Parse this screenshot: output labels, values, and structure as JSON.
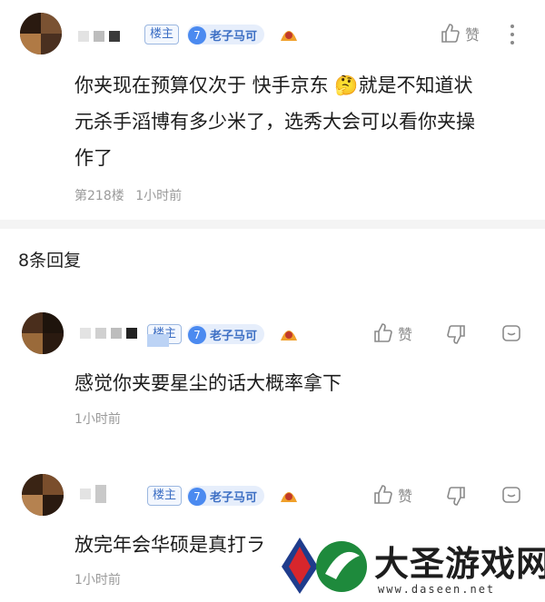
{
  "main_comment": {
    "tag": "楼主",
    "level": "7",
    "level_title": "老子马可",
    "like_label": "赞",
    "content_line1": "你夹现在预算仅次于 快手京东 🤔就是不知道状",
    "content_line2": "元杀手滔博有多少米了，选秀大会可以看你夹操",
    "content_line3": "作了",
    "floor": "第218楼",
    "time": "1小时前"
  },
  "reply_section": {
    "count_label": "8条回复"
  },
  "replies": [
    {
      "tag": "楼主",
      "level": "7",
      "level_title": "老子马可",
      "like_label": "赞",
      "content": "感觉你夹要星尘的话大概率拿下",
      "time": "1小时前"
    },
    {
      "tag": "楼主",
      "level": "7",
      "level_title": "老子马可",
      "like_label": "赞",
      "content": "放完年会华硕是真打ラ",
      "time": "1小时前"
    }
  ],
  "watermark": {
    "title": "大圣游戏网",
    "url": "www.daseen.net"
  },
  "colors": {
    "tag_blue": "#3d6fc4",
    "level_badge": "#4b8af0",
    "meta_gray": "#9a9a9a"
  }
}
